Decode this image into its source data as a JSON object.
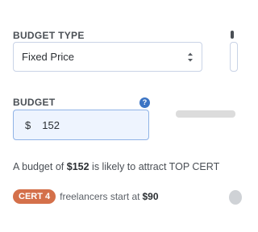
{
  "budget_type": {
    "label": "BUDGET TYPE",
    "selected": "Fixed Price"
  },
  "budget": {
    "label": "BUDGET",
    "currency": "$",
    "value": "152"
  },
  "advice": {
    "prefix": "A budget of",
    "amount": "$152",
    "middle": "is likely to attract TOP CERT"
  },
  "cert": {
    "badge": "CERT 4",
    "text": "freelancers start at",
    "price": "$90"
  },
  "icons": {
    "help": "question-mark-icon",
    "select": "chevron-up-down-icon"
  },
  "colors": {
    "accent": "#3b74c4",
    "cert_badge": "#d4704a",
    "input_bg": "#eef4fe"
  }
}
